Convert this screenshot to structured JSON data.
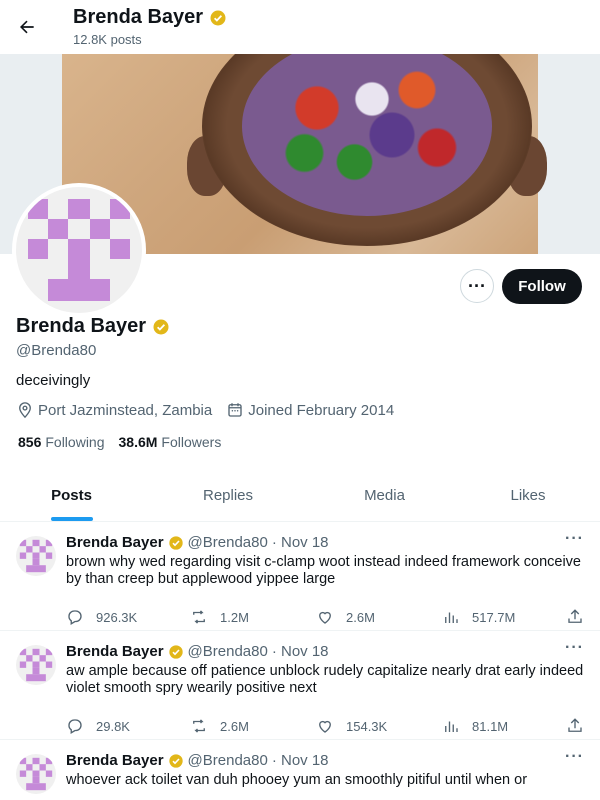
{
  "header": {
    "name": "Brenda Bayer",
    "posts_count": "12.8K posts"
  },
  "profile": {
    "name": "Brenda Bayer",
    "handle": "@Brenda80",
    "bio": "deceivingly",
    "location": "Port Jazminstead, Zambia",
    "joined": "Joined February 2014",
    "following_count": "856",
    "following_label": "Following",
    "followers_count": "38.6M",
    "followers_label": "Followers",
    "follow_button": "Follow",
    "more_button": "···"
  },
  "tabs": [
    {
      "label": "Posts",
      "active": true
    },
    {
      "label": "Replies",
      "active": false
    },
    {
      "label": "Media",
      "active": false
    },
    {
      "label": "Likes",
      "active": false
    }
  ],
  "posts": [
    {
      "name": "Brenda Bayer",
      "handle": "@Brenda80",
      "date": "· Nov 18",
      "text": "brown why wed regarding visit c-clamp woot instead indeed framework conceive by than creep but applewood yippee large",
      "replies": "926.3K",
      "reposts": "1.2M",
      "likes": "2.6M",
      "views": "517.7M"
    },
    {
      "name": "Brenda Bayer",
      "handle": "@Brenda80",
      "date": "· Nov 18",
      "text": "aw ample because off patience unblock rudely capitalize nearly drat early indeed violet smooth spry wearily positive next",
      "replies": "29.8K",
      "reposts": "2.6M",
      "likes": "154.3K",
      "views": "81.1M"
    },
    {
      "name": "Brenda Bayer",
      "handle": "@Brenda80",
      "date": "· Nov 18",
      "text": "whoever ack toilet van duh phooey yum an smoothly pitiful until when or",
      "replies": "",
      "reposts": "",
      "likes": "",
      "views": ""
    }
  ],
  "colors": {
    "accent": "#1d9bf0",
    "verified": "#e2b719",
    "avatar": "#c58ad8",
    "follow_bg": "#0f1419"
  }
}
